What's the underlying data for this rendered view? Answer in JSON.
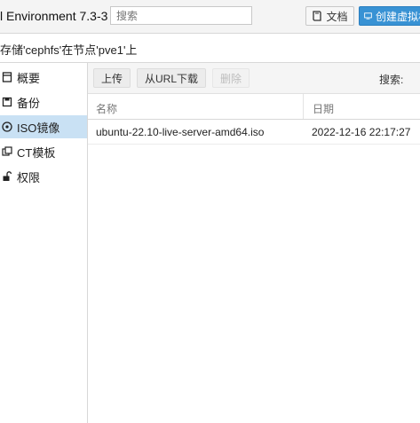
{
  "header": {
    "title": "l Environment 7.3-3",
    "search_placeholder": "搜索",
    "docs_label": "文档",
    "create_vm_label": "创建虚拟机"
  },
  "storage_title": "存储'cephfs'在节点'pve1'上",
  "sidebar": {
    "items": [
      {
        "label": "概要",
        "icon": "summary-icon"
      },
      {
        "label": "备份",
        "icon": "backup-icon"
      },
      {
        "label": "ISO镜像",
        "icon": "iso-disc-icon",
        "active": true
      },
      {
        "label": "CT模板",
        "icon": "template-icon"
      },
      {
        "label": "权限",
        "icon": "unlock-icon"
      }
    ]
  },
  "toolbar": {
    "upload_label": "上传",
    "download_url_label": "从URL下载",
    "delete_label": "删除",
    "search_label": "搜索:"
  },
  "table": {
    "columns": [
      "名称",
      "日期"
    ],
    "rows": [
      {
        "name": "ubuntu-22.10-live-server-amd64.iso",
        "date": "2022-12-16 22:17:27"
      }
    ]
  },
  "colors": {
    "accent": "#3892d4",
    "active_bg": "#c9e1f4"
  }
}
